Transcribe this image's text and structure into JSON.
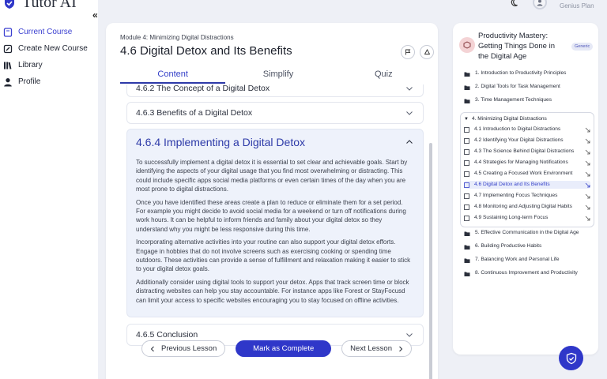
{
  "brand": {
    "name": "Tutor AI"
  },
  "sidebar": {
    "items": [
      {
        "label": "Current Course",
        "icon": "book-icon"
      },
      {
        "label": "Create New Course",
        "icon": "edit-icon"
      },
      {
        "label": "Library",
        "icon": "library-icon"
      },
      {
        "label": "Profile",
        "icon": "user-icon"
      }
    ]
  },
  "topbar": {
    "plan": "Genius Plan"
  },
  "lesson": {
    "module": "Module 4: Minimizing Digital Distractions",
    "title": "4.6 Digital Detox and Its Benefits",
    "tabs": [
      "Content",
      "Simplify",
      "Quiz"
    ],
    "sections": {
      "s2": "4.6.2 The Concept of a Digital Detox",
      "s3": "4.6.3 Benefits of a Digital Detox",
      "s4": "4.6.4 Implementing a Digital Detox",
      "s5": "4.6.5 Conclusion"
    },
    "paragraphs": [
      "To successfully implement a digital detox it is essential to set clear and achievable goals. Start by identifying the aspects of your digital usage that you find most overwhelming or distracting. This could include specific apps social media platforms or even certain times of the day when you are most prone to digital distractions.",
      "Once you have identified these areas create a plan to reduce or eliminate them for a set period. For example you might decide to avoid social media for a weekend or turn off notifications during work hours. It can be helpful to inform friends and family about your digital detox so they understand why you might be less responsive during this time.",
      "Incorporating alternative activities into your routine can also support your digital detox efforts. Engage in hobbies that do not involve screens such as exercising cooking or spending time outdoors. These activities can provide a sense of fulfillment and relaxation making it easier to stick to your digital detox goals.",
      "Additionally consider using digital tools to support your detox. Apps that track screen time or block distracting websites can help you stay accountable. For instance apps like Forest or StayFocusd can limit your access to specific websites encouraging you to stay focused on offline activities."
    ],
    "footer": {
      "prev": "Previous Lesson",
      "complete": "Mark as Complete",
      "next": "Next Lesson"
    }
  },
  "outline": {
    "course_title": "Productivity Mastery: Getting Things Done in the Digital Age",
    "badge": "Generic",
    "modules_before": [
      "1. Introduction to Productivity Principles",
      "2. Digital Tools for Task Management",
      "3. Time Management Techniques"
    ],
    "open_module": "4. Minimizing Digital Distractions",
    "lessons": [
      "4.1 Introduction to Digital Distractions",
      "4.2 Identifying Your Digital Distractions",
      "4.3 The Science Behind Digital Distractions",
      "4.4 Strategies for Managing Notifications",
      "4.5 Creating a Focused Work Environment",
      "4.6 Digital Detox and Its Benefits",
      "4.7 Implementing Focus Techniques",
      "4.8 Monitoring and Adjusting Digital Habits",
      "4.9 Sustaining Long-term Focus"
    ],
    "modules_after": [
      "5. Effective Communication in the Digital Age",
      "6. Building Productive Habits",
      "7. Balancing Work and Personal Life",
      "8. Continuous Improvement and Productivity"
    ]
  },
  "colors": {
    "accent": "#2f37c9",
    "active_text": "#3440c8",
    "open_section_bg": "#eef2fb"
  }
}
